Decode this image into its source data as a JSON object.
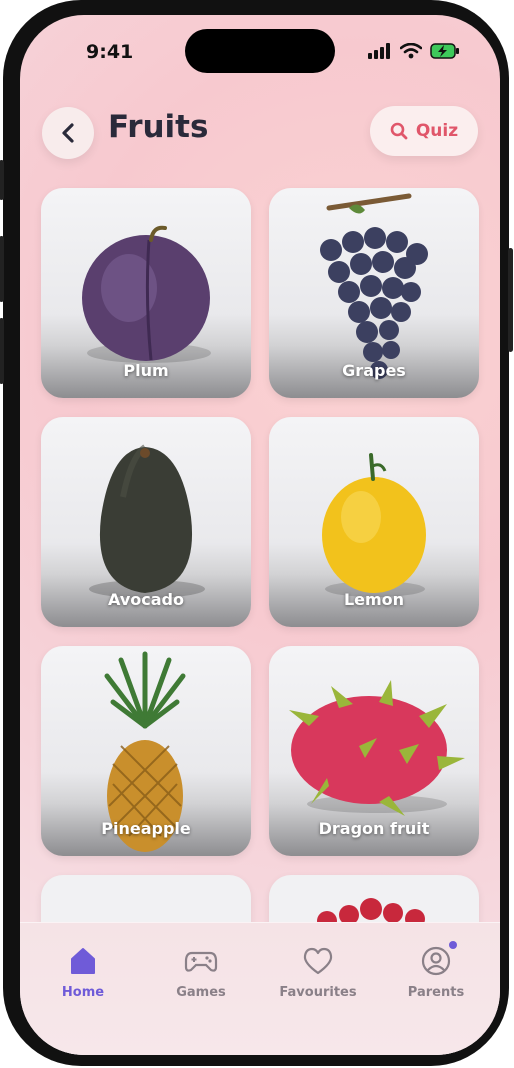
{
  "status_bar": {
    "time": "9:41"
  },
  "header": {
    "title": "Fruits",
    "quiz_label": "Quiz"
  },
  "fruits": [
    {
      "name": "Plum",
      "icon": "plum-image"
    },
    {
      "name": "Grapes",
      "icon": "grapes-image"
    },
    {
      "name": "Avocado",
      "icon": "avocado-image"
    },
    {
      "name": "Lemon",
      "icon": "lemon-image"
    },
    {
      "name": "Pineapple",
      "icon": "pineapple-image"
    },
    {
      "name": "Dragon fruit",
      "icon": "dragon-fruit-image"
    }
  ],
  "tabs": [
    {
      "label": "Home",
      "icon": "home-icon",
      "active": true
    },
    {
      "label": "Games",
      "icon": "gamepad-icon",
      "active": false
    },
    {
      "label": "Favourites",
      "icon": "heart-icon",
      "active": false
    },
    {
      "label": "Parents",
      "icon": "user-icon",
      "active": false
    }
  ],
  "colors": {
    "accent": "#6f5bd8",
    "quiz": "#e0566a",
    "title": "#2a2a3a"
  }
}
